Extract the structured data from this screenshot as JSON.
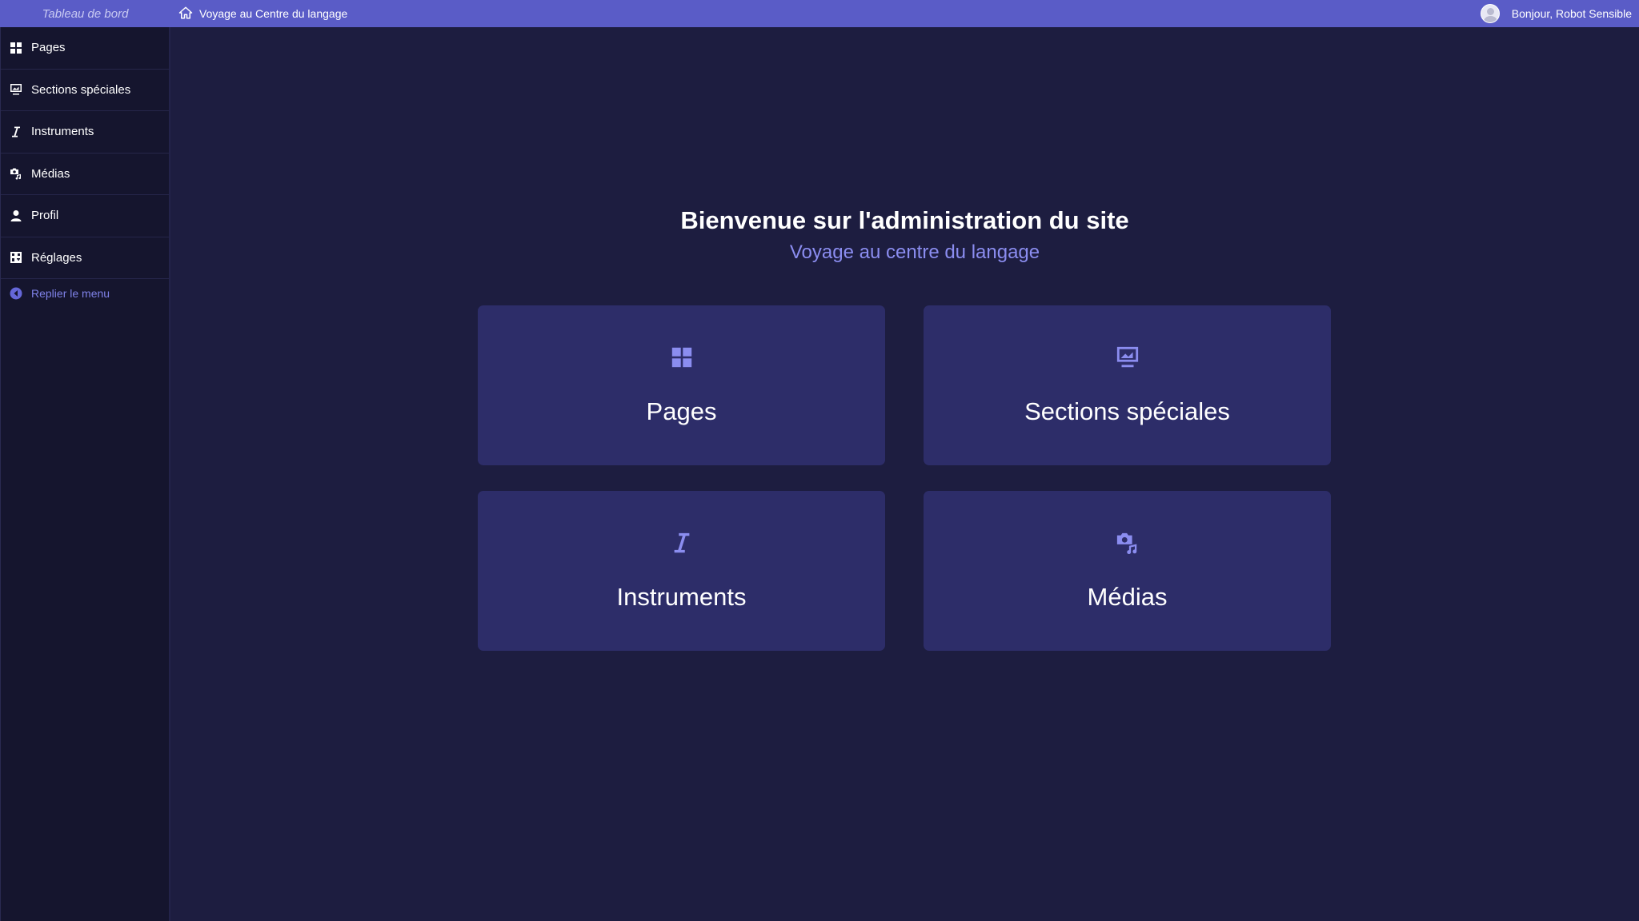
{
  "topbar": {
    "dashboard_label": "Tableau de bord",
    "site_label": "Voyage au Centre du langage",
    "greeting": "Bonjour, Robot Sensible",
    "background_color": "#5a5cc7"
  },
  "sidebar": {
    "items": [
      {
        "label": "Pages",
        "icon": "grid-icon"
      },
      {
        "label": "Sections spéciales",
        "icon": "chart-icon"
      },
      {
        "label": "Instruments",
        "icon": "italic-icon"
      },
      {
        "label": "Médias",
        "icon": "media-icon"
      },
      {
        "label": "Profil",
        "icon": "user-icon"
      },
      {
        "label": "Réglages",
        "icon": "settings-icon"
      }
    ],
    "collapse_label": "Replier le menu"
  },
  "main": {
    "title": "Bienvenue sur l'administration du site",
    "subtitle": "Voyage au centre du langage",
    "cards": [
      {
        "label": "Pages",
        "icon": "grid-icon"
      },
      {
        "label": "Sections spéciales",
        "icon": "chart-icon"
      },
      {
        "label": "Instruments",
        "icon": "italic-icon"
      },
      {
        "label": "Médias",
        "icon": "media-icon"
      }
    ],
    "accent_color": "#8b8df0",
    "card_color": "#2d2d69"
  }
}
